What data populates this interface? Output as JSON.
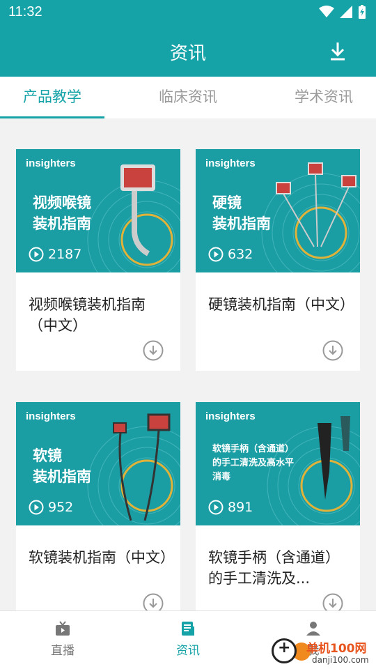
{
  "status_bar": {
    "time": "11:32"
  },
  "app_bar": {
    "title": "资讯",
    "action_icon": "download-icon"
  },
  "tabs": [
    {
      "label": "产品教学",
      "active": true
    },
    {
      "label": "临床资讯",
      "active": false
    },
    {
      "label": "学术资讯",
      "active": false
    }
  ],
  "cards": [
    {
      "brand": "insighters",
      "thumb_title": "视频喉镜\n装机指南",
      "views": "2187",
      "title": "视频喉镜装机指南（中文）"
    },
    {
      "brand": "insighters",
      "thumb_title": "硬镜\n装机指南",
      "views": "632",
      "title": "硬镜装机指南（中文）"
    },
    {
      "brand": "insighters",
      "thumb_title": "软镜\n装机指南",
      "views": "952",
      "title": "软镜装机指南（中文）"
    },
    {
      "brand": "insighters",
      "thumb_title": "软镜手柄（含通道）\n的手工清洗及高水平\n消毒",
      "views": "891",
      "title": "软镜手柄（含通道）的手工清洗及..."
    }
  ],
  "bottom_nav": [
    {
      "label": "直播",
      "icon": "tv-icon",
      "active": false
    },
    {
      "label": "资讯",
      "icon": "news-icon",
      "active": true
    },
    {
      "label": "我",
      "icon": "person-icon",
      "active": false
    }
  ],
  "watermark": {
    "line1": "单机100网",
    "line2": "danji100.com"
  },
  "colors": {
    "primary": "#16a3a8",
    "thumb_bg": "#1a9ea4",
    "ring": "#e0b23a"
  }
}
